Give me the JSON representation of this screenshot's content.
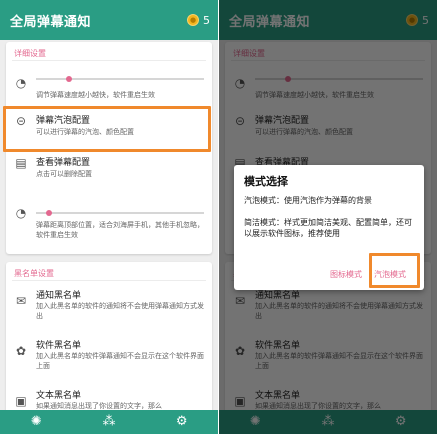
{
  "app": {
    "title": "全局弹幕通知",
    "coins": "5"
  },
  "settings": {
    "section_title": "详细设置",
    "speed_desc": "调节弹幕速度越小越快，软件重启生效",
    "bubble_title": "弹幕汽泡配置",
    "bubble_desc": "可以进行弹幕的汽泡、颜色配置",
    "view_title": "查看弹幕配置",
    "view_desc": "点击可以删除配置",
    "distance_desc": "弹幕距离顶部位置，适合刘海屏手机，其他手机忽略，软件重启生效"
  },
  "blacklist": {
    "section_title": "黑名单设置",
    "notify_title": "通知黑名单",
    "notify_desc": "加入此黑名单的软件的通知将不会使用弹幕通知方式发出",
    "app_title": "软件黑名单",
    "app_desc": "加入此黑名单的软件弹幕通知不会显示在这个软件界面上面",
    "text_title": "文本黑名单",
    "text_desc": "如果通知消息出现了你设置的文字，那么"
  },
  "dialog": {
    "title": "模式选择",
    "bubble_mode_text": "汽泡模式：使用汽泡作为弹幕的背景",
    "simple_mode_text": "简洁模式：样式更加简洁美观、配置简单，还可以展示软件图标，推荐使用",
    "icon_mode_button": "图标模式",
    "bubble_mode_button": "汽泡模式"
  },
  "icons": {
    "coin": "coin-icon",
    "nav": [
      "camera-shutter-icon",
      "bubbles-icon",
      "gear-icon"
    ]
  },
  "colors": {
    "primary": "#2a9d84",
    "accent": "#e3688f",
    "highlight": "#f0892c"
  },
  "sliders": {
    "speed": 0.18,
    "distance": 0.06
  }
}
